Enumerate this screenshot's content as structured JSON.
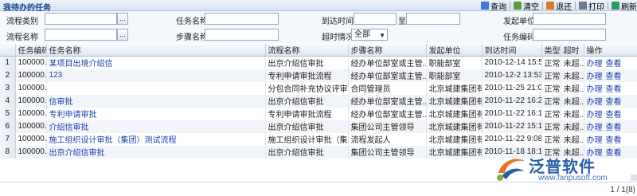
{
  "header": {
    "title": "我待办的任务"
  },
  "toolbar": {
    "query": "查询",
    "clear": "清空",
    "back": "退还",
    "print": "打印",
    "refresh": "刷新",
    "colors": {
      "query": "#3d7ad6",
      "clear": "#5c9a3a",
      "back": "#d77a2a",
      "print": "#6b7b8c",
      "refresh": "#2f9a5f"
    }
  },
  "search": {
    "process_category_label": "流程类别",
    "process_category_value": "",
    "task_name_label": "任务名称",
    "task_name_value": "",
    "arrival_time_label": "到达时间",
    "arrival_from": "",
    "to_label": "至",
    "arrival_to": "",
    "initiating_unit_label": "发起单位",
    "initiating_unit_value": "",
    "process_name_label": "流程名称",
    "process_name_value": "",
    "step_name_label": "步骤名称",
    "step_name_value": "",
    "overdue_label": "超时情况",
    "overdue_value": "全部",
    "task_code_label": "任务编码",
    "task_code_value": "",
    "picker_glyph": "..."
  },
  "table": {
    "columns": [
      "",
      "任务编码",
      "任务名称",
      "流程名称",
      "步骤名称",
      "发起单位",
      "到达时间",
      "类型",
      "超时",
      "操作"
    ],
    "rows": [
      {
        "no": "1",
        "code": "100000...",
        "task": "某项目出境介绍信",
        "process": "出京介绍信审批",
        "step": "经办单位部室或主管...",
        "unit": "职能部室",
        "time": "2010-12-14 15:56...",
        "type": "正常",
        "overdue": "未超...",
        "op1": "办理",
        "op2": "查看"
      },
      {
        "no": "2",
        "code": "100000...",
        "task": "123",
        "process": "专利申请审批流程",
        "step": "经办单位部室或主管...",
        "unit": "职能部室",
        "time": "2010-12-2 13:53:55",
        "type": "正常",
        "overdue": "未超...",
        "op1": "办理",
        "op2": "查看"
      },
      {
        "no": "3",
        "code": "100000...",
        "task": "",
        "process": "分包合同补充协议评审",
        "step": "合同管理员",
        "unit": "北京城建集团有限公...",
        "time": "2010-11-25 21:06...",
        "type": "正常",
        "overdue": "未超...",
        "op1": "办理",
        "op2": "查看"
      },
      {
        "no": "4",
        "code": "100000...",
        "task": "信审批",
        "process": "出京介绍信审批",
        "step": "经办单位部室或主管...",
        "unit": "北京城建集团有限公...",
        "time": "2010-11-22 16:21...",
        "type": "正常",
        "overdue": "未超...",
        "op1": "办理",
        "op2": "查看"
      },
      {
        "no": "5",
        "code": "100000...",
        "task": "专利申请审批",
        "process": "专利申请审批流程",
        "step": "经办单位部室或主管...",
        "unit": "北京城建集团有限公...",
        "time": "2010-11-22 16:15...",
        "type": "正常",
        "overdue": "未超...",
        "op1": "办理",
        "op2": "查看"
      },
      {
        "no": "6",
        "code": "100000...",
        "task": "介绍信审批",
        "process": "出京介绍信审批",
        "step": "集团公司主管领导",
        "unit": "北京城建集团有限公...",
        "time": "2010-11-22 15:18...",
        "type": "正常",
        "overdue": "未超...",
        "op1": "办理",
        "op2": "查看"
      },
      {
        "no": "7",
        "code": "100000...",
        "task": "施工组织设计审批（集团）测试流程",
        "process": "施工组织设计审批（集...",
        "step": "流程发起人",
        "unit": "北京城建集团有限公...",
        "time": "2010-11-22 9:08:04",
        "type": "正常",
        "overdue": "未超...",
        "op1": "办理",
        "op2": "查看"
      },
      {
        "no": "8",
        "code": "100000...",
        "task": "出京介绍信审批",
        "process": "出京介绍信审批",
        "step": "集团公司主管领导",
        "unit": "北京城建集团有限公...",
        "time": "2010-11-18 18:19...",
        "type": "正常",
        "overdue": "未超...",
        "op1": "办理",
        "op2": "查看"
      }
    ]
  },
  "footer": {
    "page_info": "1 / 1(8)"
  },
  "logo": {
    "name": "泛普软件",
    "url": "www.fanpusoft.com"
  }
}
